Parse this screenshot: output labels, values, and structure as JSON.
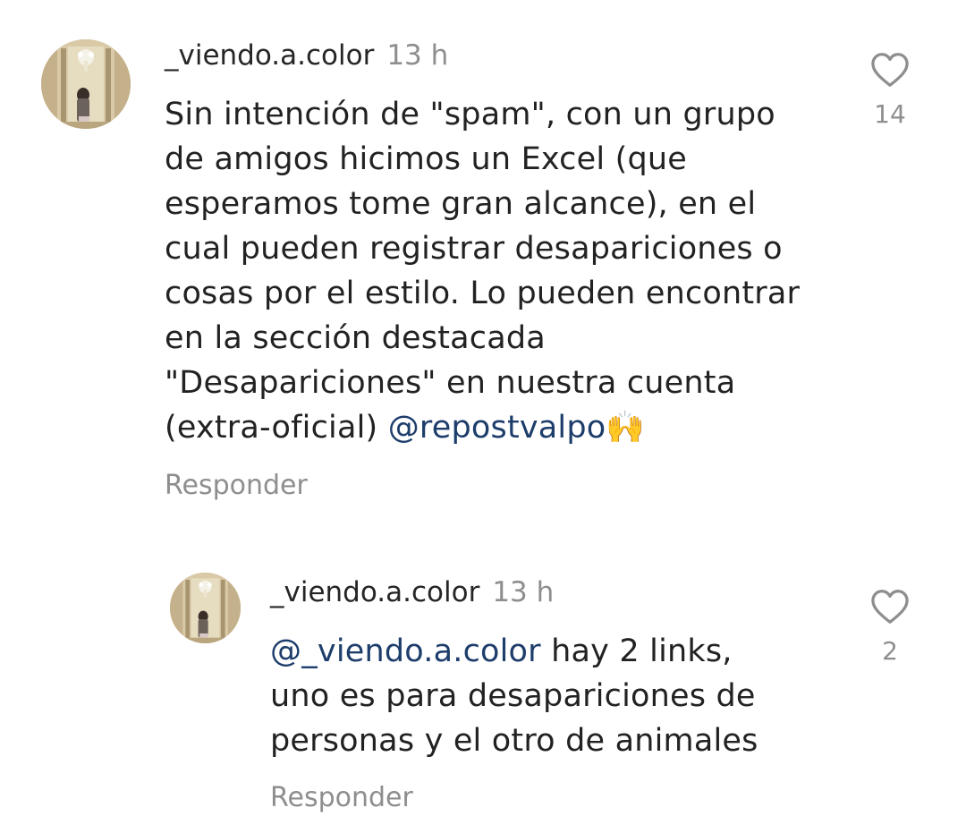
{
  "comments": [
    {
      "username": "_viendo.a.color",
      "time": "13 h",
      "text_before": "Sin intención de \"spam\", con un grupo de amigos hicimos un Excel (que esperamos tome gran alcance), en el cual pueden registrar desapariciones o cosas por el estilo. Lo pueden encontrar en la sección destacada \"Desapariciones\" en nuestra cuenta (extra-oficial) ",
      "mention": "@repostvalpo",
      "text_after": "🙌",
      "reply_label": "Responder",
      "likes": "14",
      "like_icon": "heart-outline-icon"
    },
    {
      "username": "_viendo.a.color",
      "time": "13 h",
      "mention": "@_viendo.a.color",
      "text_after": " hay 2 links, uno es para desapariciones de personas y el otro de animales",
      "reply_label": "Responder",
      "likes": "2",
      "like_icon": "heart-outline-icon"
    }
  ],
  "colors": {
    "mention": "#1d3d6b",
    "muted": "#8e8e8e",
    "text": "#222222"
  }
}
